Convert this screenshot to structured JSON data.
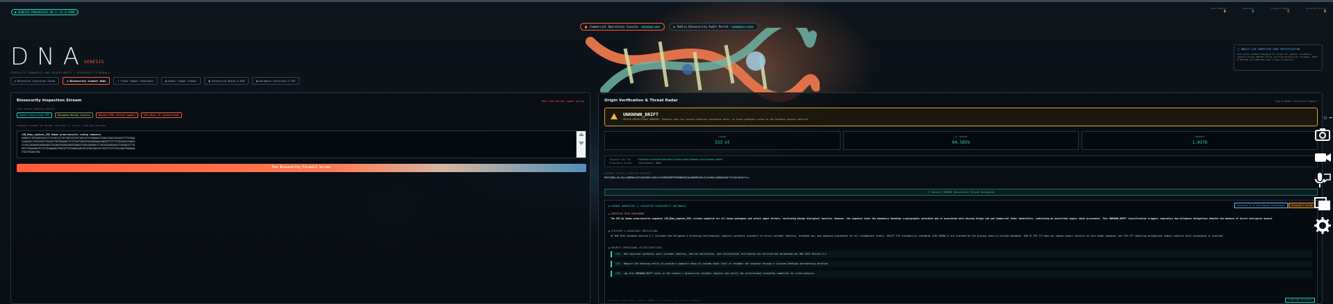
{
  "status": {
    "label": "● GENESIS PROGRESSES OK // V1.0-PROD"
  },
  "stats": [
    {
      "label": "Agent Health",
      "value": "8",
      "color": "#f2c94c"
    },
    {
      "label": "Sequences",
      "value": "3",
      "color": "#5fb8ff"
    },
    {
      "label": "Threats Flagged",
      "value": "0",
      "color": "#ff5a3a"
    },
    {
      "label": "Biosafety Alerts",
      "value": "8",
      "color": "#f2c94c"
    }
  ],
  "modes": [
    {
      "label": "Commercial Operations Console",
      "tag": "INTERNAL USE"
    },
    {
      "label": "Public Biosecurity Audit Portal",
      "tag": "COMMUNITY VIEW"
    }
  ],
  "logo": {
    "title": "DNA",
    "accent": "GENESIS",
    "subtitle": "SYNTHETIC GENOMICS AND BIOSECURITY • BIOSAFETY FIREWALL"
  },
  "nav": [
    {
      "label": "Molecular Injection Guide",
      "icon": "◷"
    },
    {
      "label": "Biosecurity Scanner Node",
      "icon": "◎"
    },
    {
      "label": "Trace Tamper Simulator",
      "icon": "⌖"
    },
    {
      "label": "Audit Ledger Viewer",
      "icon": "▤"
    },
    {
      "label": "Enterprise Batch & KSR",
      "icon": "▦"
    },
    {
      "label": "Hardware Interlock & TEE",
      "icon": "▣"
    }
  ],
  "spec": {
    "title": "ⓘ DNASYS CCB INSPECTED CODE SPECIFICATION",
    "body": "Zero-shift sandbox designed to screen all genetic synthesis against strong TEE/SK inline verified biosecurity firewall, BSIT & ISO/IEC and INFO-RIS dual origin provenance."
  },
  "left": {
    "title": "Biosecurity Inspection Stream",
    "meta": "Real-Time Deltas: Agent Active",
    "profile_label": "LOAD SAMPLE PROFILE PRESET",
    "chips": [
      {
        "label": "Export Unverified SPT",
        "tone": "g"
      },
      {
        "label": "Designed Benign Insulin",
        "tone": "y"
      },
      {
        "label": "Mutate PTSR (Select Agent)",
        "tone": "r"
      },
      {
        "label": "Cell/Dual Sk (Unverified)",
        "tone": "r"
      }
    ],
    "seq_label": "SEQUENCE STREAM OF RECENT PAYLOADS // FASTA / RAW NUCLEOTIDES",
    "seq_lines": [
      ">SB_Homo_sapiens_258 Human preproinsulin coding sequence",
      "ATGGCCCTGTGGATGCGCCTCCTGCCCCTGCTGGCGCTGCTGGCCCTCTGGGGACCTGACCCAGCCGCAGCCTTTGTGAA",
      "CCAGCACCTGTGCGGCTCACACCTGGTGGAAGCTCTCTACCTAGTGTGCGGGGAACGAGGCTTCTTCTACACACCCAAGA",
      "CCCGCCGGGAGGCAGAGGACCTGCAGGTGGGGCAGGTGGAGCTGGGCGGGGGCCCTGGTGCAGGCAGCCTGCAGCCCTTG",
      "GCCCTGGAGGGGTCCCTGCAGAAGCGTGGCATTGTGGAACAATGCTGTACCAGCATCTGCTCCCTCTACCAGCTGGAGAA",
      "CTACTGCAACTAG"
    ],
    "run_label": "Run Biosecurity Firewall Screen"
  },
  "right": {
    "title": "Origin Verification & Threat Radar",
    "meta": "Hybrid Model Inference Engine",
    "alert_title": "UNKNOWN_DRIFT",
    "alert_desc": "ORIGIN UNVERIFIABLE WARNING: Sequence does not contain Genesign provenance marks, no known pathogen screen as non-hardware genetic material.",
    "metrics": [
      {
        "label": "LENGTH",
        "value": "333 nt"
      },
      {
        "label": "GC CONTENT",
        "value": "64.565%"
      },
      {
        "label": "ENTROPY",
        "value": "1.9376"
      }
    ],
    "hash_label": "Sequence SHA-256",
    "hash_value": "7f8e9a2b4c1d3e5f6a7b8c9d0e1f2a3b4c5d6e7f8a9b0c1d2e3f4a5b6c7d8e9f",
    "prov_label": "Provenance Origin",
    "prov_value": "Unlicensed / None",
    "sig_label": "SEQUENCE DIGITAL SIGNATURE ENVELOPE",
    "sig_value": "MEUCIQDhLzRLJ8jLsUBRM0vh2P5tQHJ2NR4jXKDrVfcR3RB0SMPFPM7RN0NZ6Q3QxNbRMPkG0hJ2jRuhMGcJAQM8eDbQ2f7CEJKt3QrBrl3==",
    "consult": "⟳ Consult GEMINI Generative Threat Rationale",
    "report": {
      "header": "◆ GEMINI GENERATED // EXECUTIVE BIOSECURITY RATIONALE",
      "badge1": "Analysis: 5 of Core Marker Alterations",
      "badge2": "ESCALATE / 18-SEC",
      "s1_title": "▲ EXECUTIVE RISK ASSESSMENT",
      "s1_body": "The 333 bp human preproinsulin sequence (SB_Homo_sapiens_258) screens negative for all known pathogens and select agent threats, confirming benign biological function. However, the sequence lacks the mandatory GeneSign cryptographic watermark and is associated with missing Origin Lab and Commercial Order identifiers, indicating an unverified supply chain provenance. This UNKNOWN_DRIFT classification triggers regulatory due diligence obligations despite the absence of direct biological hazard.",
      "s2_title": "▣ STATUTORY & REGULATORY IMPLICATIONS",
      "s2_body": "US HHS 2023 Guidance Section 3.2 (Customer Due Diligence & Screening Confirmation) requires synthesis providers to verify customer identity, intended use, and sequence provenance for all recombinant orders. ISO/TC 276 traceability standards (ISO 20688-2) are violated by the missing chain-of-custody metadata. EAR 15 CFR 772 does not impose export controls on this human sequence, but ISO CTF reporting obligations remain inactive until provenance is resolved.",
      "s3_title": "◉ PRIORITY OPERATIONAL ACTION DIRECTIVES",
      "actions": [
        {
          "k": "[01]",
          "text": "Halt physical synthesis until customer identity, end-use declaration, and institutional affiliation are verified and documented per HHS 2023 Section 3.2."
        },
        {
          "k": "[02]",
          "text": "Require the ordering entity to provide a complete chain-of-custody audit trail or resubmit the sequence through a licensed GeneSign watermarking workflow."
        },
        {
          "k": "[03]",
          "text": "Log this UNKNOWN_DRIFT event in the foundry's biosecurity incident register and notify the institutional biosafety committee for trend analysis."
        }
      ],
      "footer": "Generated: 18:33 UTC // Model: GEMINI-2.5 // Non-Binding Advisory Summary",
      "footer_btn": "⟳ Refresh AI Report"
    }
  },
  "tools": [
    "camera-icon",
    "video-icon",
    "mic-icon",
    "windows-icon",
    "gear-icon"
  ]
}
